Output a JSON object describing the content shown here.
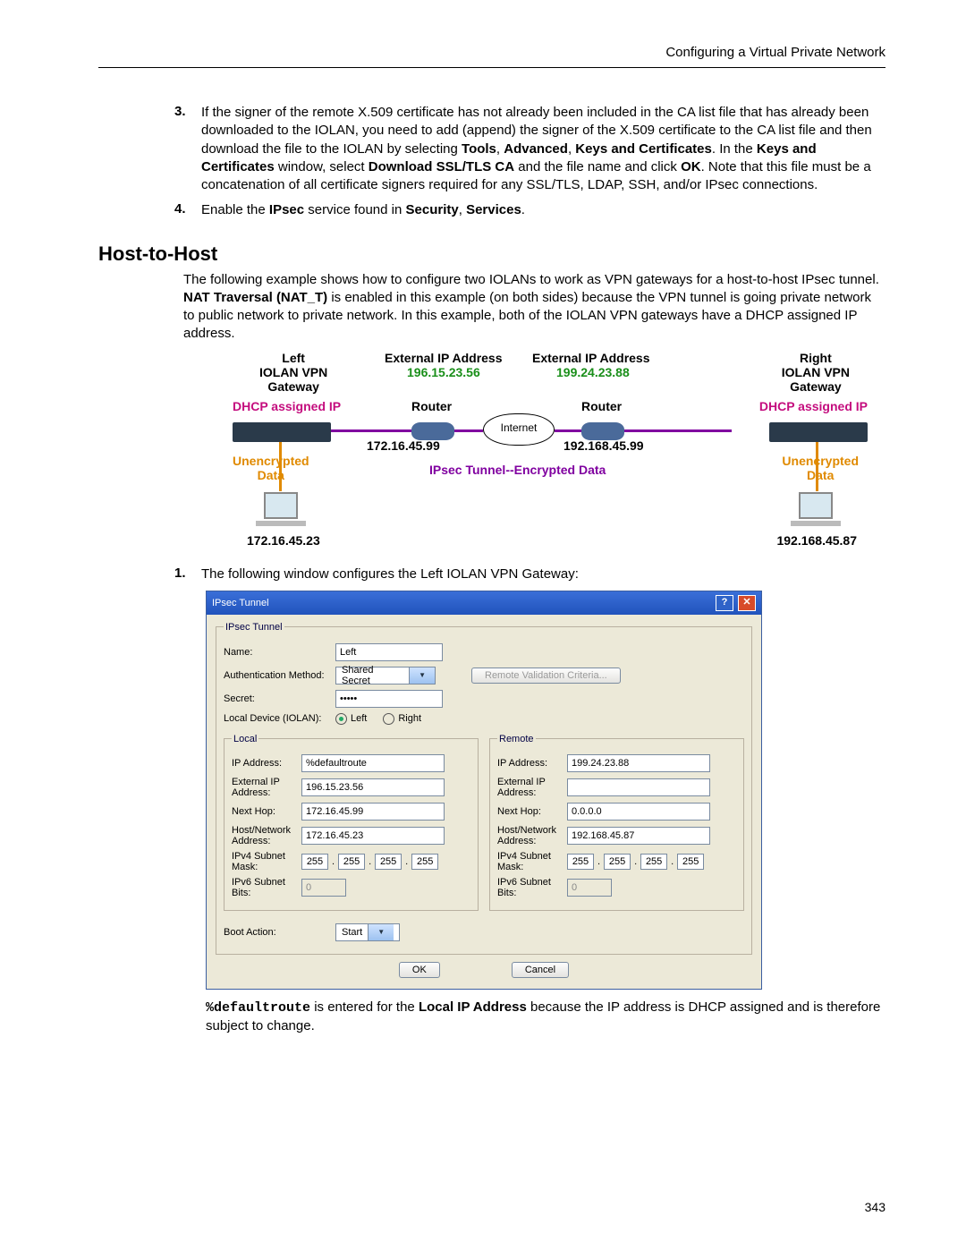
{
  "header": {
    "right": "Configuring a Virtual Private Network"
  },
  "steps": {
    "s3": {
      "num": "3.",
      "pre": "If the signer of the remote X.509 certificate has not already been included in the CA list file that has already been downloaded to the IOLAN, you need to add (append) the signer of the X.509 certificate to the CA list file and then download the file to the IOLAN by selecting ",
      "b1": "Tools",
      "sep1": ", ",
      "b2": "Advanced",
      "sep2": ", ",
      "b3": "Keys and Certificates",
      "mid1": ". In the ",
      "b4": "Keys and Certificates",
      "mid2": " window, select ",
      "b5": "Download SSL/TLS CA",
      "mid3": " and the file name and click ",
      "b6": "OK",
      "tail": ". Note that this file must be a concatenation of all certificate signers required for any SSL/TLS, LDAP, SSH, and/or IPsec connections."
    },
    "s4": {
      "num": "4.",
      "pre": "Enable the ",
      "b1": "IPsec",
      "mid": " service found in ",
      "b2": "Security",
      "sep": ", ",
      "b3": "Services",
      "tail": "."
    }
  },
  "section": {
    "title": "Host-to-Host"
  },
  "intro": {
    "t1": "The following example shows how to configure two IOLANs to work as VPN gateways for a host-to-host IPsec tunnel. ",
    "b1": "NAT Traversal (NAT_T)",
    "t2": " is enabled in this example (on both sides) because the VPN tunnel is going private network to public network to private network. In this example, both of the IOLAN VPN gateways have a DHCP assigned IP address."
  },
  "diagram": {
    "leftTitle1": "Left",
    "leftTitle2": "IOLAN VPN",
    "leftTitle3": "Gateway",
    "rightTitle1": "Right",
    "rightTitle2": "IOLAN VPN",
    "rightTitle3": "Gateway",
    "extIpLabel": "External IP Address",
    "leftExtIp": "196.15.23.56",
    "rightExtIp": "199.24.23.88",
    "dhcp": "DHCP assigned IP",
    "router": "Router",
    "internet": "Internet",
    "leftInner": "172.16.45.99",
    "rightInner": "192.168.45.99",
    "unenc": "Unencrypted",
    "data": "Data",
    "tunnel": "IPsec Tunnel--Encrypted Data",
    "leftHost": "172.16.45.23",
    "rightHost": "192.168.45.87"
  },
  "step1": {
    "num": "1.",
    "text": "The following window configures the Left IOLAN VPN Gateway:"
  },
  "dialog": {
    "title": "IPsec Tunnel",
    "groupTitle": "IPsec Tunnel",
    "name_lbl": "Name:",
    "name_val": "Left",
    "auth_lbl": "Authentication Method:",
    "auth_val": "Shared Secret",
    "remoteValBtn": "Remote Validation Criteria...",
    "secret_lbl": "Secret:",
    "secret_val": "•••••",
    "localdev_lbl": "Local Device (IOLAN):",
    "radio_left": "Left",
    "radio_right": "Right",
    "local_legend": "Local",
    "remote_legend": "Remote",
    "ip_lbl": "IP Address:",
    "ext_lbl": "External IP Address:",
    "nh_lbl": "Next Hop:",
    "hn_lbl": "Host/Network Address:",
    "v4_lbl": "IPv4 Subnet Mask:",
    "v6_lbl": "IPv6 Subnet Bits:",
    "local": {
      "ip": "%defaultroute",
      "ext": "196.15.23.56",
      "nh": "172.16.45.99",
      "hn": "172.16.45.23",
      "mask": [
        "255",
        "255",
        "255",
        "255"
      ],
      "v6": "0"
    },
    "remote": {
      "ip": "199.24.23.88",
      "ext": "",
      "nh": "0.0.0.0",
      "hn": "192.168.45.87",
      "mask": [
        "255",
        "255",
        "255",
        "255"
      ],
      "v6": "0"
    },
    "boot_lbl": "Boot Action:",
    "boot_val": "Start",
    "ok": "OK",
    "cancel": "Cancel"
  },
  "footnote": {
    "code": "%defaultroute",
    "t1": " is entered for the ",
    "b1": "Local IP Address",
    "t2": " because the IP address is DHCP assigned and is therefore subject to change."
  },
  "page_number": "343"
}
